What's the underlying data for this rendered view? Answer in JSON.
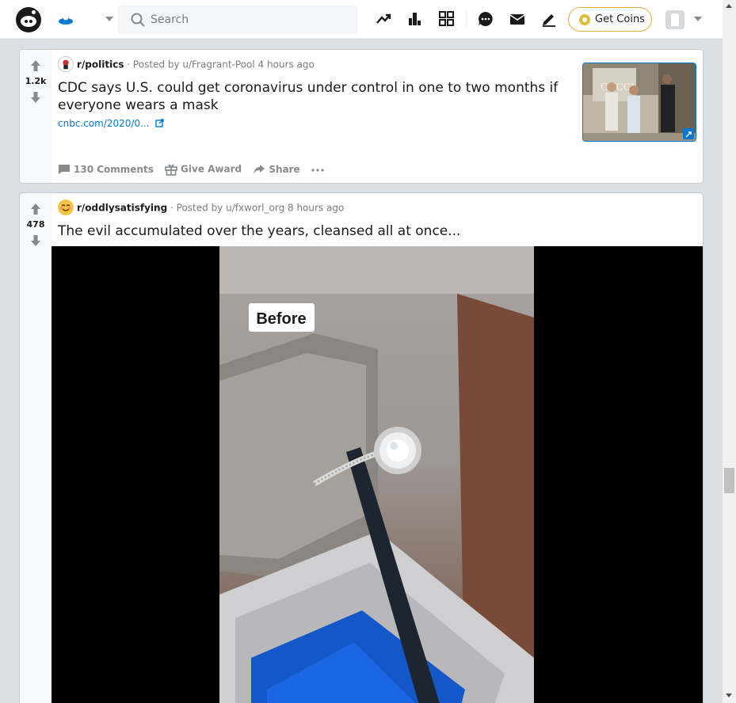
{
  "header": {
    "search_placeholder": "Search",
    "get_coins_label": "Get Coins"
  },
  "posts": [
    {
      "score": "1.2k",
      "subreddit": "r/politics",
      "posted_by": "· Posted by u/Fragrant-Pool 4 hours ago",
      "title": "CDC says U.S. could get coronavirus under control in one to two months if everyone wears a mask",
      "link": "cnbc.com/2020/0...",
      "comments": "130 Comments",
      "award": "Give Award",
      "share": "Share"
    },
    {
      "score": "478",
      "subreddit": "r/oddlysatisfying",
      "posted_by": "· Posted by u/fxworl_org 8 hours ago",
      "title": "The evil accumulated over the years, cleansed all at once...",
      "video_caption": "Before"
    }
  ],
  "thumbnail_sign": "GUCCI",
  "colors": {
    "accent": "#0079d3",
    "coins_border": "#dcb03d",
    "page_bg": "#dae0e6"
  }
}
